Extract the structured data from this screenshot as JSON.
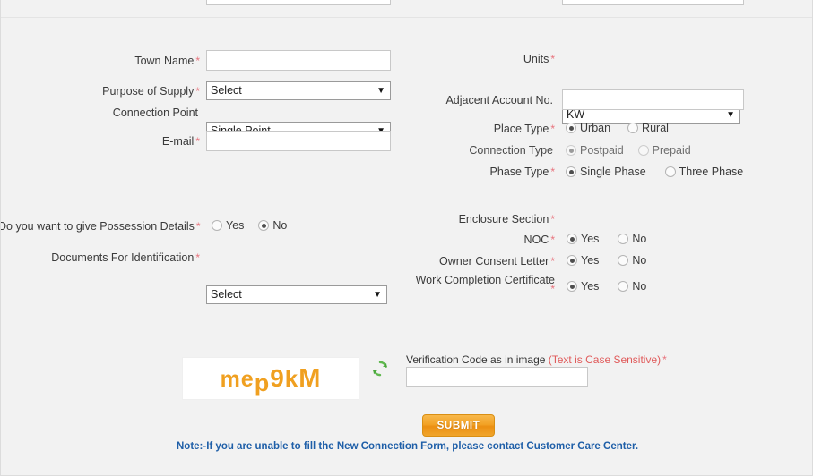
{
  "form": {
    "left_column": {
      "town_name": {
        "label": "Town Name",
        "required": "*",
        "value": "",
        "placeholder": ""
      },
      "purpose_of_supply": {
        "label": "Purpose of Supply",
        "required": "*",
        "value": "Select"
      },
      "connection_point": {
        "label": "Connection Point",
        "required": "",
        "value": "Single Point"
      },
      "email": {
        "label": "E-mail",
        "required": "*",
        "value": "",
        "placeholder": ""
      },
      "possession_details": {
        "label": "Do you want to give Possession Details",
        "required": "*",
        "options": [
          {
            "label": "Yes",
            "selected": false
          },
          {
            "label": "No",
            "selected": true
          }
        ]
      },
      "documents_for_identification": {
        "label": "Documents For Identification",
        "required": "*",
        "value": "Select"
      }
    },
    "right_column": {
      "units": {
        "label": "Units",
        "required": "*",
        "value": "KW"
      },
      "adjacent_account_no": {
        "label": "Adjacent Account No.",
        "required": "",
        "value": "",
        "placeholder": ""
      },
      "place_type": {
        "label": "Place Type",
        "required": "*",
        "options": [
          {
            "label": "Urban",
            "selected": true
          },
          {
            "label": "Rural",
            "selected": false
          }
        ]
      },
      "connection_type": {
        "label": "Connection Type",
        "required": "",
        "disabled": true,
        "options": [
          {
            "label": "Postpaid",
            "selected": true
          },
          {
            "label": "Prepaid",
            "selected": false
          }
        ]
      },
      "phase_type": {
        "label": "Phase Type",
        "required": "*",
        "options": [
          {
            "label": "Single Phase",
            "selected": true
          },
          {
            "label": "Three Phase",
            "selected": false
          }
        ]
      },
      "enclosure_section": {
        "label": "Enclosure Section",
        "required": "*"
      },
      "noc": {
        "label": "NOC",
        "required": "*",
        "options": [
          {
            "label": "Yes",
            "selected": true
          },
          {
            "label": "No",
            "selected": false
          }
        ]
      },
      "owner_consent_letter": {
        "label": "Owner Consent Letter",
        "required": "*",
        "options": [
          {
            "label": "Yes",
            "selected": true
          },
          {
            "label": "No",
            "selected": false
          }
        ]
      },
      "work_completion_certificate": {
        "label": "Work Completion Certificate",
        "required": "*",
        "options": [
          {
            "label": "Yes",
            "selected": true
          },
          {
            "label": "No",
            "selected": false
          }
        ]
      }
    }
  },
  "captcha": {
    "image_text": "mep9kM",
    "chars": [
      "m",
      "e",
      "p",
      "9",
      "k",
      "M"
    ],
    "refresh_icon": "refresh-icon",
    "label_main": "Verification Code as in image",
    "label_case": "(Text is Case Sensitive)",
    "label_required": "*",
    "input_value": "",
    "input_placeholder": ""
  },
  "actions": {
    "submit_label": "SUBMIT",
    "note": "Note:-If you are unable to fill the New Connection Form, please contact Customer Care Center."
  },
  "colors": {
    "page_bg": "#f2f2f2",
    "required_star": "#e8737d",
    "captcha_text": "#f0a020",
    "refresh_icon": "#4eae42",
    "submit_orange": "#f2a226",
    "note_blue": "#1f5fa8",
    "case_sensitive_red": "#e05a5a"
  }
}
